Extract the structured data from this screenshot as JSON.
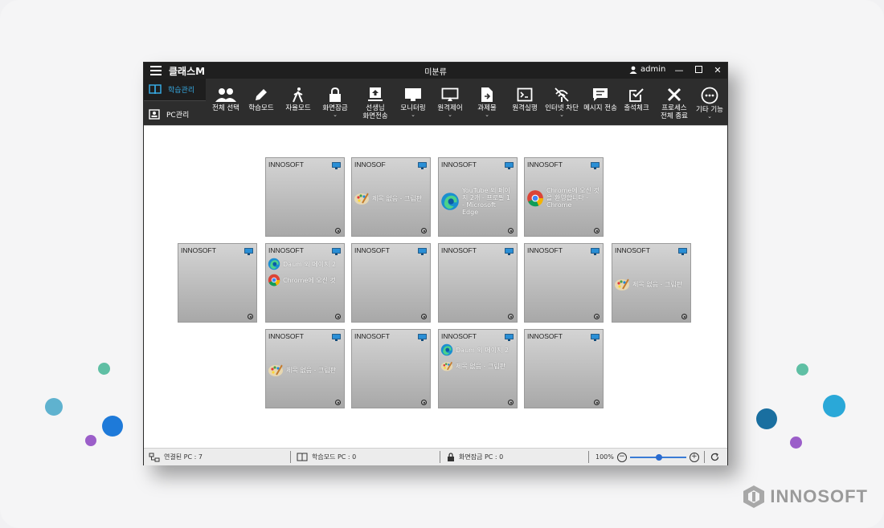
{
  "app": {
    "title": "클래스M",
    "group": "미분류",
    "user": "admin"
  },
  "side_tabs": [
    {
      "label": "학습관리",
      "icon": "book-icon",
      "active": true
    },
    {
      "label": "PC관리",
      "icon": "user-card-icon",
      "active": false
    }
  ],
  "toolbar": [
    {
      "label": "전체 선택",
      "icon": "users-icon"
    },
    {
      "label": "학습모드",
      "icon": "pencil-icon"
    },
    {
      "label": "자율모드",
      "icon": "walking-icon"
    },
    {
      "label": "화면잠금",
      "icon": "lock-icon",
      "dropdown": true
    },
    {
      "label": "선생님\n화면전송",
      "icon": "upload-screen-icon"
    },
    {
      "label": "모니터링",
      "icon": "monitor-icon",
      "dropdown": true
    },
    {
      "label": "원격제어",
      "icon": "remote-screen-icon",
      "dropdown": true
    },
    {
      "label": "과제물",
      "icon": "file-send-icon",
      "dropdown": true
    },
    {
      "label": "원격실행",
      "icon": "terminal-icon"
    },
    {
      "label": "인터넷 차단",
      "icon": "wifi-block-icon",
      "dropdown": true
    },
    {
      "label": "메시지 전송",
      "icon": "message-icon"
    },
    {
      "label": "출석체크",
      "icon": "check-box-icon"
    },
    {
      "label": "프로세스\n전체 종료",
      "icon": "process-kill-icon"
    },
    {
      "label": "기타 기능",
      "icon": "more-icon",
      "dropdown": true
    }
  ],
  "tiles": [
    {
      "name": "INNOSOFT",
      "apps": []
    },
    {
      "name": "INNOSOF",
      "apps": [
        {
          "icon": "paint-icon",
          "text": "제목 없음 - 그림판"
        }
      ]
    },
    {
      "name": "INNOSOFT",
      "apps": [
        {
          "icon": "edge-icon",
          "text": "YouTube 외 페이지 2개 - 프로필 1 - Microsoft Edge"
        }
      ]
    },
    {
      "name": "INNOSOFT",
      "apps": [
        {
          "icon": "chrome-icon",
          "text": "Chrome에 오신 것을 환영합니다 - Chrome"
        }
      ]
    },
    {
      "name": "INNOSOFT",
      "apps": []
    },
    {
      "name": "INNOSOFT",
      "apps": [
        {
          "icon": "edge-icon",
          "text": "Daum 외 페이지 2"
        },
        {
          "icon": "chrome-icon",
          "text": "Chrome에 오신 것"
        }
      ]
    },
    {
      "name": "INNOSOFT",
      "apps": []
    },
    {
      "name": "INNOSOFT",
      "apps": []
    },
    {
      "name": "INNOSOFT",
      "apps": []
    },
    {
      "name": "INNOSOFT",
      "apps": [
        {
          "icon": "paint-icon",
          "text": "제목 없음 - 그림판"
        }
      ]
    },
    {
      "name": "INNOSOFT",
      "apps": [
        {
          "icon": "paint-icon",
          "text": "제목 없음 - 그림판"
        }
      ]
    },
    {
      "name": "INNOSOFT",
      "apps": []
    },
    {
      "name": "INNOSOFT",
      "apps": [
        {
          "icon": "edge-icon",
          "text": "Daum 외 페이지 2"
        },
        {
          "icon": "paint-icon",
          "text": "제목 없음 - 그림판"
        }
      ]
    },
    {
      "name": "INNOSOFT",
      "apps": []
    }
  ],
  "status": {
    "connected": "연결된 PC :  7",
    "learning": "학습모드 PC :  0",
    "locked": "화면잠금 PC :  0",
    "zoom": "100%"
  },
  "brand": "INNOSOFT"
}
